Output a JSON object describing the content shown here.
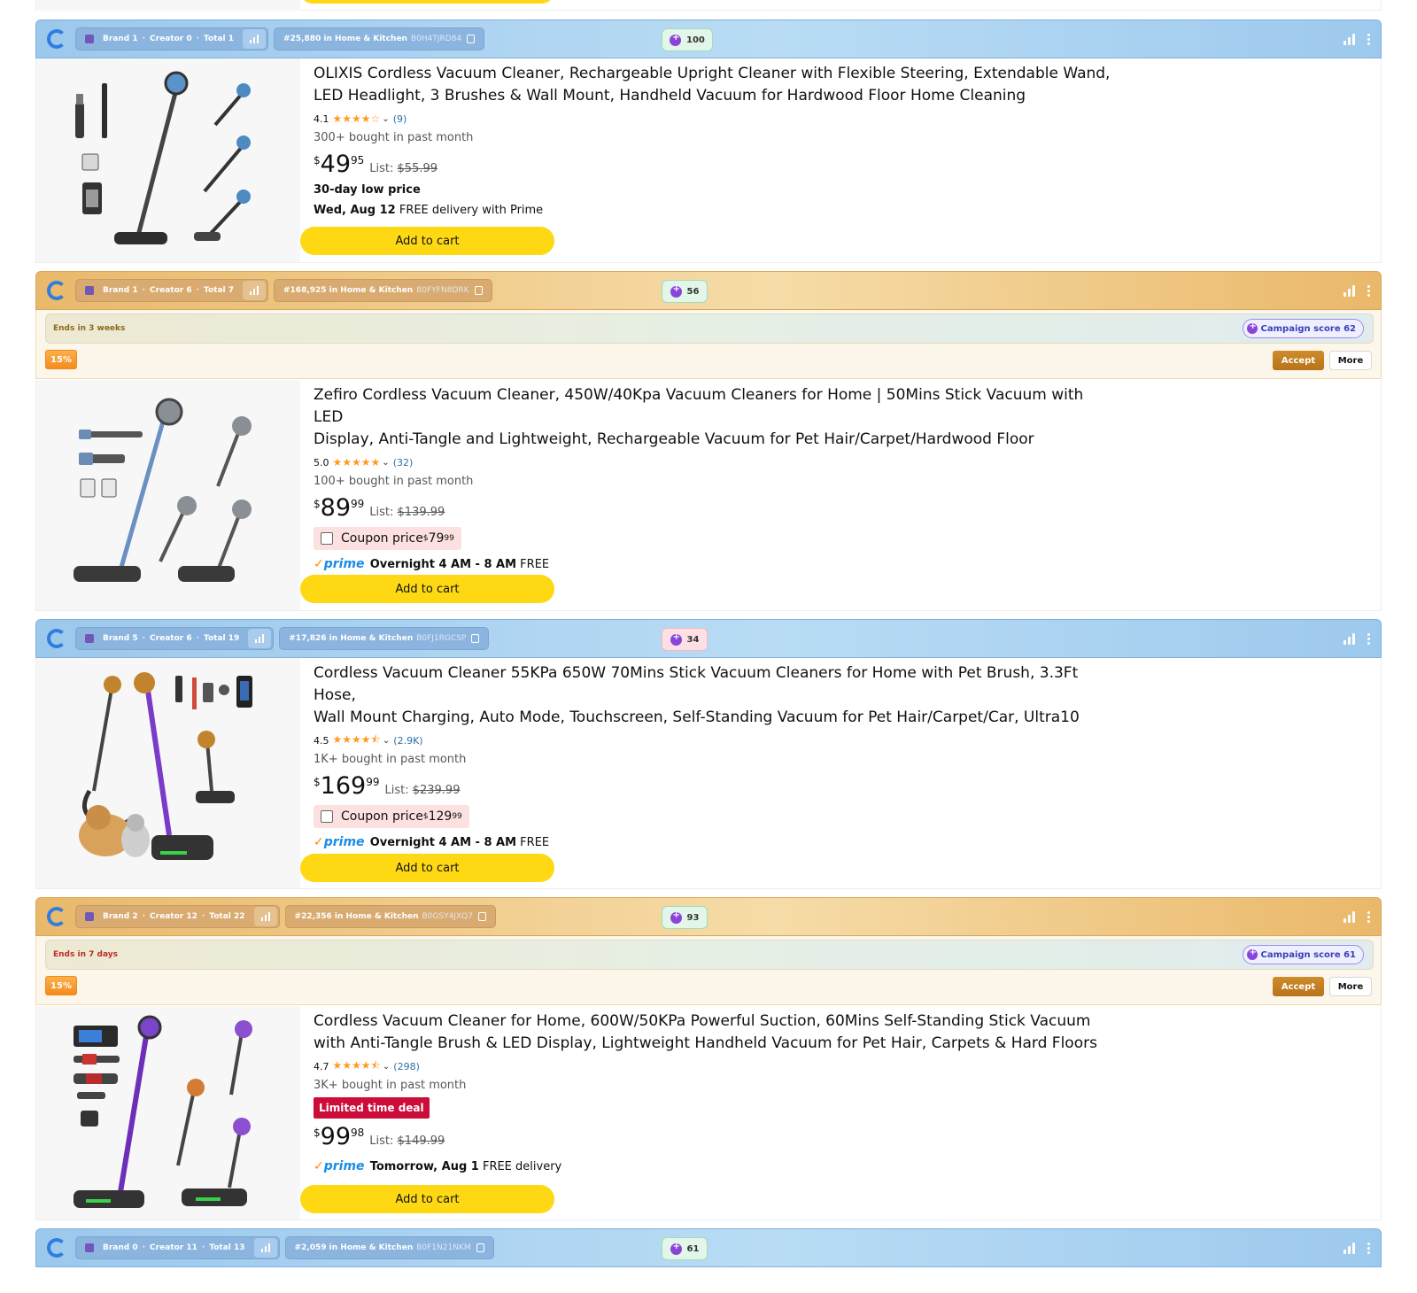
{
  "products": [
    {
      "bar": {
        "style": "blue",
        "brand": "Brand 1",
        "creator": "Creator 0",
        "total": "Total 1",
        "rank": "#25,880 in Home & Kitchen",
        "asin": "B0H4TJRD84",
        "score": "100"
      },
      "title_line1": "OLIXIS Cordless Vacuum Cleaner, Rechargeable Upright Cleaner with Flexible Steering, Extendable Wand,",
      "title_line2": "LED Headlight, 3 Brushes & Wall Mount, Handheld Vacuum for Hardwood Floor Home Cleaning",
      "rating": "4.1",
      "stars": "★★★★☆",
      "reviews": "(9)",
      "bought": "300+ bought in past month",
      "price_cur": "$",
      "price_whole": "49",
      "price_frac": "95",
      "list_label": "List:",
      "list_price": "$55.99",
      "low_price": "30-day low price",
      "delivery_bold": "Wed, Aug 12",
      "delivery_rest": " FREE delivery with Prime",
      "cart": "Add to cart"
    },
    {
      "bar": {
        "style": "gold",
        "brand": "Brand 1",
        "creator": "Creator 6",
        "total": "Total 7",
        "rank": "#168,925 in Home & Kitchen",
        "asin": "B0FYFN8DRK",
        "score": "56"
      },
      "campaign": {
        "ends": "Ends in 3 weeks",
        "ends_color": "#8a6a1a",
        "score": "Campaign score 62",
        "discount": "15%",
        "accept": "Accept",
        "more": "More"
      },
      "title_line1": "Zefiro Cordless Vacuum Cleaner, 450W/40Kpa Vacuum Cleaners for Home | 50Mins Stick Vacuum with LED",
      "title_line2": "Display, Anti-Tangle and Lightweight, Rechargeable Vacuum for Pet Hair/Carpet/Hardwood Floor",
      "rating": "5.0",
      "stars": "★★★★★",
      "reviews": "(32)",
      "bought": "100+ bought in past month",
      "price_cur": "$",
      "price_whole": "89",
      "price_frac": "99",
      "list_label": "List:",
      "list_price": "$139.99",
      "coupon_label": "Coupon price ",
      "coupon_cur": "$",
      "coupon_whole": "79",
      "coupon_frac": "99",
      "prime_word": "prime",
      "prime_bold": "Overnight 4 AM - 8 AM",
      "prime_rest": " FREE delivery",
      "cart": "Add to cart"
    },
    {
      "bar": {
        "style": "blue",
        "brand": "Brand 5",
        "creator": "Creator 6",
        "total": "Total 19",
        "rank": "#17,826 in Home & Kitchen",
        "asin": "B0FJ1RGCSP",
        "score": "34"
      },
      "title_line1": "Cordless Vacuum Cleaner 55KPa 650W 70Mins Stick Vacuum Cleaners for Home with Pet Brush, 3.3Ft Hose,",
      "title_line2": "Wall Mount Charging, Auto Mode, Touchscreen, Self-Standing Vacuum for Pet Hair/Carpet/Car, Ultra10",
      "rating": "4.5",
      "stars": "★★★★⯪",
      "reviews": "(2.9K)",
      "bought": "1K+ bought in past month",
      "price_cur": "$",
      "price_whole": "169",
      "price_frac": "99",
      "list_label": "List:",
      "list_price": "$239.99",
      "coupon_label": "Coupon price ",
      "coupon_cur": "$",
      "coupon_whole": "129",
      "coupon_frac": "99",
      "prime_word": "prime",
      "prime_bold": "Overnight 4 AM - 8 AM",
      "prime_rest": " FREE delivery",
      "cart": "Add to cart"
    },
    {
      "bar": {
        "style": "gold",
        "brand": "Brand 2",
        "creator": "Creator 12",
        "total": "Total 22",
        "rank": "#22,356 in Home & Kitchen",
        "asin": "B0GSY4JXQ7",
        "score": "93"
      },
      "campaign": {
        "ends": "Ends in 7 days",
        "ends_color": "#c0292a",
        "score": "Campaign score 61",
        "discount": "15%",
        "accept": "Accept",
        "more": "More"
      },
      "title_line1": "Cordless Vacuum Cleaner for Home, 600W/50KPa Powerful Suction, 60Mins Self-Standing Stick Vacuum",
      "title_line2": "with Anti-Tangle Brush & LED Display, Lightweight Handheld Vacuum for Pet Hair, Carpets & Hard Floors",
      "rating": "4.7",
      "stars": "★★★★⯪",
      "reviews": "(298)",
      "bought": "3K+ bought in past month",
      "deal": "Limited time deal",
      "price_cur": "$",
      "price_whole": "99",
      "price_frac": "98",
      "list_label": "List:",
      "list_price": "$149.99",
      "prime_word": "prime",
      "prime_bold": "Tomorrow, Aug 1",
      "prime_rest": " FREE delivery",
      "cart": "Add to cart"
    }
  ],
  "last_bar": {
    "style": "blue",
    "brand": "Brand 0",
    "creator": "Creator 11",
    "total": "Total 13",
    "rank": "#2,059 in Home & Kitchen",
    "asin": "B0F1N21NKM",
    "score": "61"
  },
  "icons": {
    "logo": "extension-logo-icon",
    "chart": "bar-chart-icon",
    "copy": "copy-icon",
    "signal": "signal-icon",
    "kebab": "kebab-icon",
    "chevron": "chevron-down-icon",
    "prime_check": "prime-check-icon"
  },
  "colors": {
    "cart_button": "#ffd814",
    "deal_badge": "#cc0c39",
    "star": "#ff9a1e",
    "prime": "#1a8ce6",
    "accept_button": "#b8731a"
  }
}
